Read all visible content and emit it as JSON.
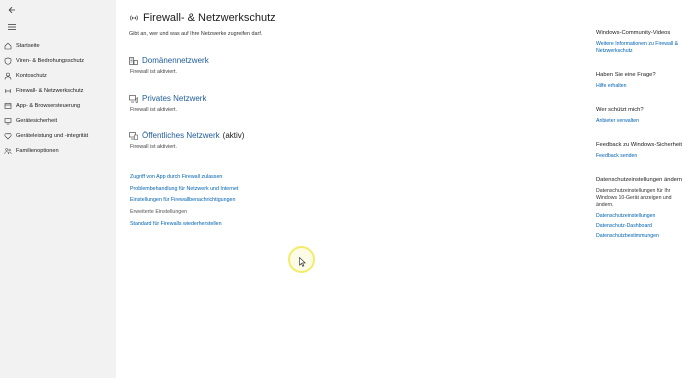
{
  "sidebar": {
    "back_icon": "back-arrow-icon",
    "menu_icon": "hamburger-icon",
    "items": [
      {
        "label": "Startseite",
        "icon": "home-icon"
      },
      {
        "label": "Viren- & Bedrohungsschutz",
        "icon": "shield-icon"
      },
      {
        "label": "Kontoschutz",
        "icon": "person-icon"
      },
      {
        "label": "Firewall- & Netzwerkschutz",
        "icon": "wireless-icon"
      },
      {
        "label": "App- & Browsersteuerung",
        "icon": "app-window-icon"
      },
      {
        "label": "Gerätesicherheit",
        "icon": "device-icon"
      },
      {
        "label": "Geräteleistung und -integrität",
        "icon": "heart-icon"
      },
      {
        "label": "Familienoptionen",
        "icon": "family-icon"
      }
    ]
  },
  "main": {
    "title": "Firewall- & Netzwerkschutz",
    "title_icon": "wireless-icon",
    "subtitle": "Gibt an, wer und was auf Ihre Netzwerke zugreifen darf.",
    "networks": [
      {
        "name": "Domänennetzwerk",
        "active": "",
        "status": "Firewall ist aktiviert.",
        "icon": "domain-network-icon"
      },
      {
        "name": "Privates Netzwerk",
        "active": "",
        "status": "Firewall ist aktiviert.",
        "icon": "private-network-icon"
      },
      {
        "name": "Öffentliches Netzwerk",
        "active": "(aktiv)",
        "status": "Firewall ist aktiviert.",
        "icon": "public-network-icon"
      }
    ],
    "links": [
      {
        "label": "Zugriff von App durch Firewall zulassen",
        "plain": false
      },
      {
        "label": "Problembehandlung für Netzwerk und Internet",
        "plain": false
      },
      {
        "label": "Einstellungen für Firewallbenachrichtigungen",
        "plain": false
      },
      {
        "label": "Erweiterte Einstellungen",
        "plain": true
      },
      {
        "label": "Standard für Firewalls wiederherstellen",
        "plain": false
      }
    ]
  },
  "right": {
    "community": {
      "heading": "Windows-Community-Videos",
      "link_line1": "Weitere Informationen zu Firewall &",
      "link_line2": "Netzwerkschutz"
    },
    "question": {
      "heading": "Haben Sie eine Frage?",
      "link": "Hilfe erhalten"
    },
    "protector": {
      "heading": "Wer schützt mich?",
      "link": "Anbieter verwalten"
    },
    "feedback": {
      "heading": "Feedback zu Windows-Sicherheit",
      "link": "Feedback senden"
    },
    "privacy": {
      "heading": "Datenschutzeinstellungen ändern",
      "text_line1": "Datenschutzeinstellungen für Ihr",
      "text_line2": "Windows 10-Gerät anzeigen und",
      "text_line3": "ändern.",
      "links": [
        "Datenschutzeinstellungen",
        "Datenschutz-Dashboard",
        "Datenschutzbestimmungen"
      ]
    }
  },
  "colors": {
    "link": "#0063b1",
    "network_link": "#1f5c99",
    "sidebar_bg": "#f2f2f2",
    "cursor_highlight": "#f3ec6a"
  }
}
